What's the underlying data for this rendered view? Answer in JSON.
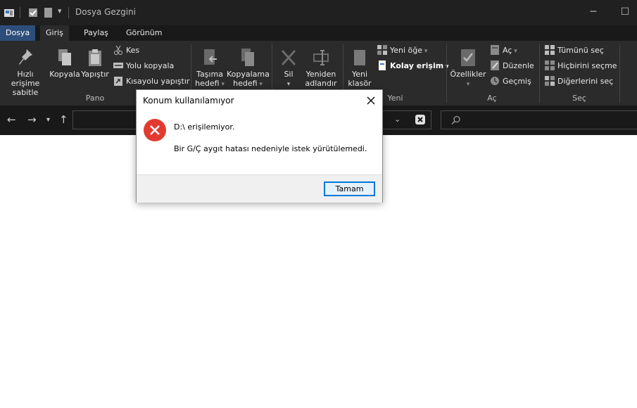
{
  "window": {
    "title": "Dosya Gezgini"
  },
  "tabs": [
    {
      "label": "Dosya"
    },
    {
      "label": "Giriş"
    },
    {
      "label": "Paylaş"
    },
    {
      "label": "Görünüm"
    }
  ],
  "ribbon": {
    "pano": {
      "label": "Pano",
      "pin_line1": "Hızlı erişime",
      "pin_line2": "sabitle",
      "copy": "Kopyala",
      "paste": "Yapıştır",
      "cut": "Kes",
      "copy_path": "Yolu kopyala",
      "paste_shortcut": "Kısayolu yapıştır"
    },
    "duzenle": {
      "move_line1": "Taşıma",
      "move_line2": "hedefi",
      "copyto_line1": "Kopyalama",
      "copyto_line2": "hedefi",
      "delete": "Sil",
      "rename_line1": "Yeniden",
      "rename_line2": "adlandır"
    },
    "yeni": {
      "label": "Yeni",
      "folder_line1": "Yeni",
      "folder_line2": "klasör",
      "new_item": "Yeni öğe",
      "easy_access": "Kolay erişim"
    },
    "ac": {
      "label": "Aç",
      "properties": "Özellikler",
      "open": "Aç",
      "edit": "Düzenle",
      "history": "Geçmiş"
    },
    "sec": {
      "label": "Seç",
      "select_all": "Tümünü seç",
      "select_none": "Hiçbirini seçme",
      "invert": "Diğerlerini seç"
    }
  },
  "dialog": {
    "title": "Konum kullanılamıyor",
    "message": "D:\\ erişilemiyor.",
    "detail": "Bir G/Ç aygıt hatası nedeniyle istek yürütülemedi.",
    "ok_label": "Tamam"
  }
}
